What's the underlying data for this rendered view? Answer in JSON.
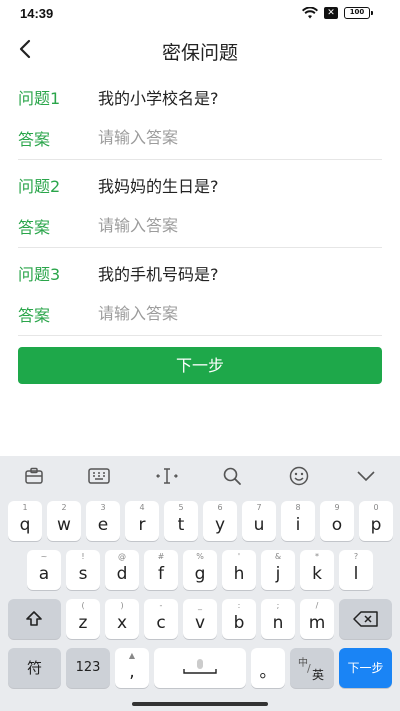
{
  "status_bar": {
    "time": "14:39",
    "battery": "100"
  },
  "nav": {
    "title": "密保问题"
  },
  "form": {
    "questions": [
      {
        "label": "问题1",
        "question": "我的小学校名是?",
        "answer_label": "答案",
        "answer_placeholder": "请输入答案",
        "answer_value": ""
      },
      {
        "label": "问题2",
        "question": "我妈妈的生日是?",
        "answer_label": "答案",
        "answer_placeholder": "请输入答案",
        "answer_value": ""
      },
      {
        "label": "问题3",
        "question": "我的手机号码是?",
        "answer_label": "答案",
        "answer_placeholder": "请输入答案",
        "answer_value": ""
      }
    ],
    "next_button": "下一步"
  },
  "keyboard": {
    "row1": [
      {
        "main": "q",
        "sub": "1"
      },
      {
        "main": "w",
        "sub": "2"
      },
      {
        "main": "e",
        "sub": "3"
      },
      {
        "main": "r",
        "sub": "4"
      },
      {
        "main": "t",
        "sub": "5"
      },
      {
        "main": "y",
        "sub": "6"
      },
      {
        "main": "u",
        "sub": "7"
      },
      {
        "main": "i",
        "sub": "8"
      },
      {
        "main": "o",
        "sub": "9"
      },
      {
        "main": "p",
        "sub": "0"
      }
    ],
    "row2": [
      {
        "main": "a",
        "sub": "~"
      },
      {
        "main": "s",
        "sub": "!"
      },
      {
        "main": "d",
        "sub": "@"
      },
      {
        "main": "f",
        "sub": "#"
      },
      {
        "main": "g",
        "sub": "%"
      },
      {
        "main": "h",
        "sub": "'"
      },
      {
        "main": "j",
        "sub": "&"
      },
      {
        "main": "k",
        "sub": "*"
      },
      {
        "main": "l",
        "sub": "?"
      }
    ],
    "row3": [
      {
        "main": "z",
        "sub": "("
      },
      {
        "main": "x",
        "sub": ")"
      },
      {
        "main": "c",
        "sub": "-"
      },
      {
        "main": "v",
        "sub": "_"
      },
      {
        "main": "b",
        "sub": ":"
      },
      {
        "main": "n",
        "sub": ";"
      },
      {
        "main": "m",
        "sub": "/"
      }
    ],
    "symbol_key": "符",
    "num_key": "123",
    "comma_key": ",",
    "period_key": "。",
    "lang_key_top": "中",
    "lang_key_bottom": "英",
    "enter_key": "下一步"
  },
  "colors": {
    "accent": "#2aa54a",
    "button": "#1ea84a",
    "enter": "#1a84f5"
  }
}
